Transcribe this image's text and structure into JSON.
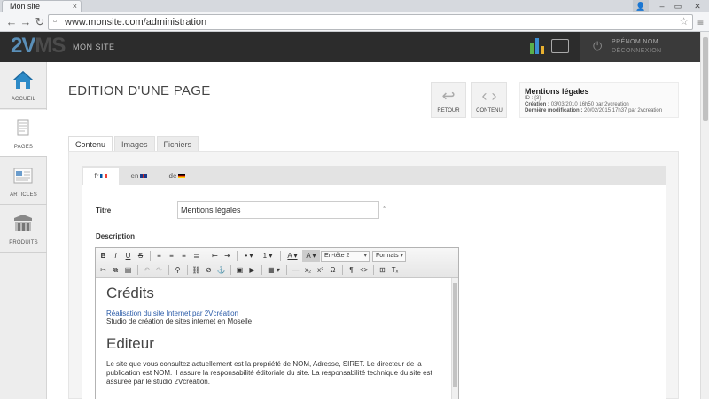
{
  "browser": {
    "tab_title": "Mon site",
    "url": "www.monsite.com/administration"
  },
  "header": {
    "logo_part1": "2V",
    "logo_part2": "MS",
    "site_name": "MON SITE",
    "user_name": "PRÉNOM NOM",
    "logout": "DÉCONNEXION"
  },
  "sidebar": {
    "items": [
      {
        "label": "ACCUEIL",
        "icon": "home-icon"
      },
      {
        "label": "PAGES",
        "icon": "pages-icon"
      },
      {
        "label": "ARTICLES",
        "icon": "articles-icon"
      },
      {
        "label": "PRODUITS",
        "icon": "products-icon"
      }
    ]
  },
  "main": {
    "title": "EDITION D'UNE PAGE",
    "actions": [
      {
        "label": "RETOUR"
      },
      {
        "label": "CONTENU"
      }
    ],
    "info": {
      "title": "Mentions légales",
      "id_line": "ID : {3}",
      "creation_label": "Création :",
      "creation_value": "03/03/2010 16h50 par 2vcreation",
      "modification_label": "Dernière modification :",
      "modification_value": "20/02/2015 17h37 par 2vcreation"
    },
    "tabs": [
      "Contenu",
      "Images",
      "Fichiers"
    ],
    "lang_tabs": [
      "fr",
      "en",
      "de"
    ],
    "form": {
      "title_label": "Titre",
      "title_value": "Mentions légales",
      "required_mark": "*",
      "description_label": "Description"
    },
    "toolbar": {
      "heading_select": "En-tête 2",
      "formats_select": "Formats"
    },
    "editor": {
      "h1": "Crédits",
      "link": "Réalisation du site Internet par 2Vcréation",
      "line": "Studio de création de sites internet en Moselle",
      "h2": "Editeur",
      "paragraph": "Le site que vous consultez actuellement est la propriété de NOM, Adresse, SIRET. Le directeur de la publication est NOM. Il assure la responsabilité éditoriale du site. La responsabilité technique du site est assurée par le studio 2Vcréation."
    }
  },
  "colors": {
    "accent": "#5a8fb8",
    "header_bg": "#2c2c2c",
    "link": "#2a5ba8"
  }
}
